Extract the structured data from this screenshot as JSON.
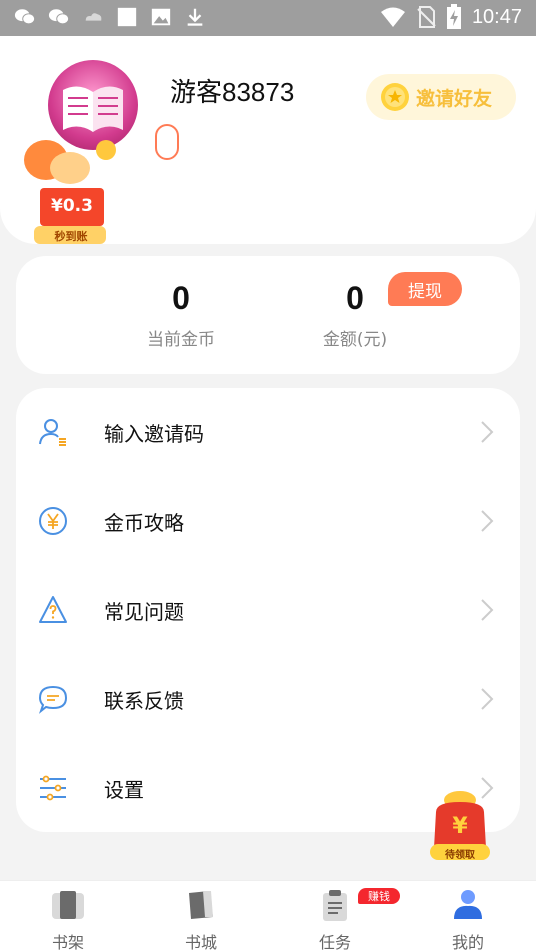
{
  "status_bar": {
    "time": "10:47",
    "icons": [
      "wechat-icon",
      "wechat-icon",
      "cloud-icon",
      "square-icon",
      "image-icon",
      "download-icon"
    ],
    "right_icons": [
      "wifi-icon",
      "no-sim-icon",
      "battery-charging-icon"
    ]
  },
  "profile": {
    "username": "游客83873",
    "invite_label": "邀请好友",
    "promo_amount": "¥0.3",
    "promo_sub": "秒到账"
  },
  "stats": {
    "coins_value": "0",
    "coins_label": "当前金币",
    "amount_value": "0",
    "amount_label": "金额(元)",
    "withdraw_label": "提现"
  },
  "menu": {
    "items": [
      {
        "label": "输入邀请码",
        "icon": "user-invite-icon"
      },
      {
        "label": "金币攻略",
        "icon": "yen-coin-icon"
      },
      {
        "label": "常见问题",
        "icon": "question-icon"
      },
      {
        "label": "联系反馈",
        "icon": "chat-bubble-icon"
      },
      {
        "label": "设置",
        "icon": "settings-sliders-icon"
      }
    ]
  },
  "red_packet": {
    "label": "待领取",
    "symbol": "¥"
  },
  "bottom_nav": {
    "items": [
      {
        "label": "书架",
        "icon": "bookshelf-icon"
      },
      {
        "label": "书城",
        "icon": "bookstore-icon"
      },
      {
        "label": "任务",
        "icon": "task-icon"
      },
      {
        "label": "我的",
        "icon": "profile-icon"
      }
    ],
    "earn_badge": "赚钱",
    "active": "我的"
  },
  "colors": {
    "accent": "#ff7b55",
    "icon_blue": "#4a90e2",
    "invite_gold": "#f7bf3c",
    "badge_red": "#f4272e"
  }
}
